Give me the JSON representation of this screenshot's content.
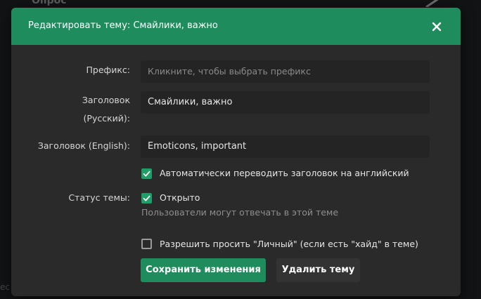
{
  "background": {
    "heading": "Опрос",
    "edge_text": "ес"
  },
  "modal": {
    "title": "Редактировать тему: Смайлики, важно",
    "close_icon": "close-icon",
    "accent_color": "#1f8c5e"
  },
  "form": {
    "prefix": {
      "label": "Префикс:",
      "placeholder": "Кликните, чтобы выбрать префикс"
    },
    "title_ru": {
      "label_line1": "Заголовок",
      "label_line2": "(Русский):",
      "value": "Смайлики, важно"
    },
    "title_en": {
      "label": "Заголовок (English):",
      "value": "Emoticons, important"
    },
    "auto_translate": {
      "label": "Автоматически переводить заголовок на английский",
      "checked": true
    },
    "status": {
      "label": "Статус темы:",
      "option_label": "Открыто",
      "checked": true,
      "hint": "Пользователи могут отвечать в этой теме"
    },
    "allow_personal": {
      "label": "Разрешить просить \"Личный\" (если есть \"хайд\" в теме)",
      "checked": false
    }
  },
  "buttons": {
    "save": "Сохранить изменения",
    "delete": "Удалить тему"
  }
}
